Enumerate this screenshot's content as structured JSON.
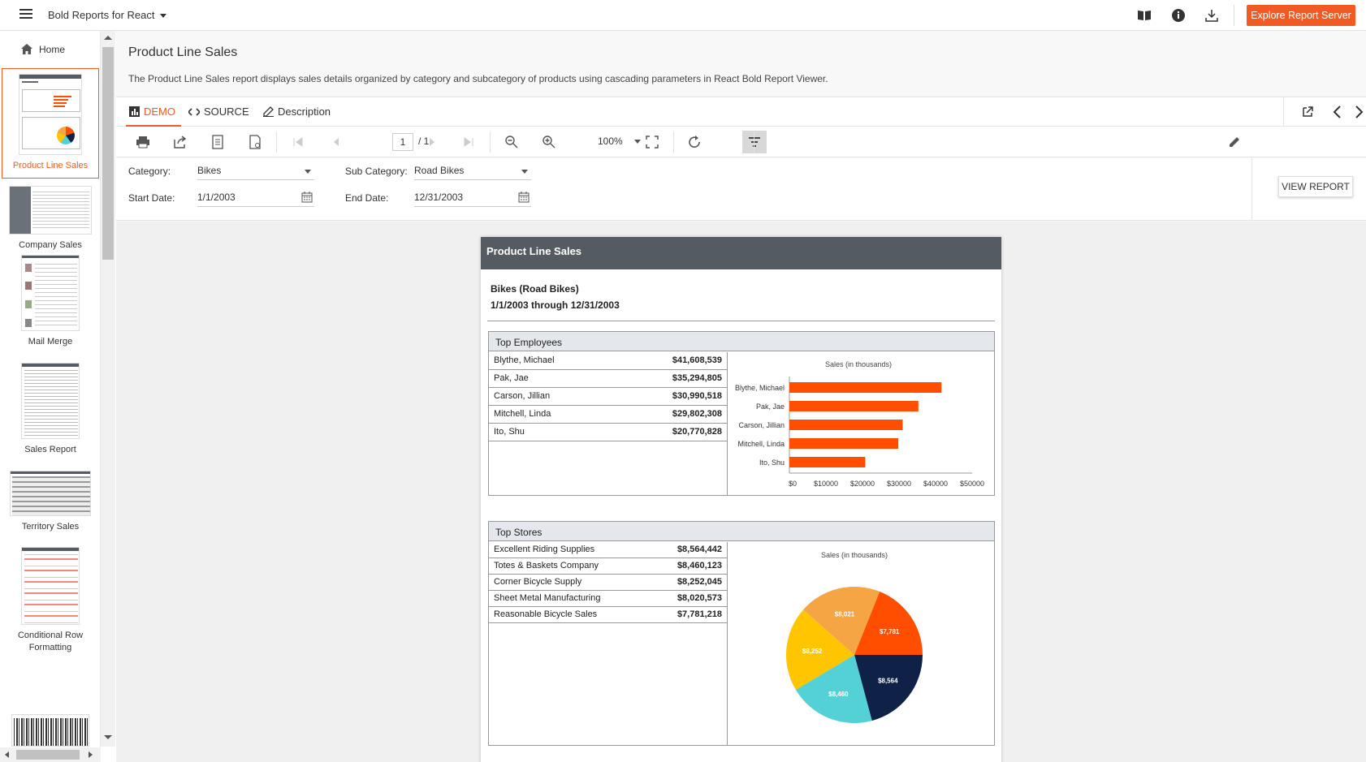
{
  "app": {
    "title": "Bold Reports for React",
    "explore_button": "Explore Report Server",
    "icons": [
      "book-icon",
      "info-icon",
      "download-icon"
    ]
  },
  "sidebar": {
    "home": "Home",
    "items": [
      {
        "label": "Product Line Sales",
        "active": true
      },
      {
        "label": "Company Sales",
        "active": false
      },
      {
        "label": "Mail Merge",
        "active": false
      },
      {
        "label": "Sales Report",
        "active": false
      },
      {
        "label": "Territory Sales",
        "active": false
      },
      {
        "label": "Conditional Row Formatting",
        "active": false
      }
    ]
  },
  "page": {
    "title": "Product Line Sales",
    "description": "The Product Line Sales report displays sales details organized by category and subcategory of products using cascading parameters in React Bold Report Viewer."
  },
  "tabs": [
    {
      "label": "DEMO",
      "active": true
    },
    {
      "label": "SOURCE",
      "active": false
    },
    {
      "label": "Description",
      "active": false
    }
  ],
  "toolbar": {
    "current_page": "1",
    "total_pages": "/ 1",
    "zoom": "100%"
  },
  "params": {
    "category_label": "Category:",
    "category_value": "Bikes",
    "subcategory_label": "Sub Category:",
    "subcategory_value": "Road Bikes",
    "start_label": "Start Date:",
    "start_value": "1/1/2003",
    "end_label": "End Date:",
    "end_value": "12/31/2003",
    "view_button": "VIEW REPORT"
  },
  "report": {
    "header": "Product Line Sales",
    "subtitle": "Bikes (Road Bikes)",
    "date_range": "1/1/2003 through 12/31/2003",
    "employees": {
      "title": "Top Employees",
      "rows": [
        {
          "name": "Blythe, Michael",
          "value": "$41,608,539"
        },
        {
          "name": "Pak, Jae",
          "value": "$35,294,805"
        },
        {
          "name": "Carson, Jillian",
          "value": "$30,990,518"
        },
        {
          "name": "Mitchell, Linda",
          "value": "$29,802,308"
        },
        {
          "name": "Ito, Shu",
          "value": "$20,770,828"
        }
      ]
    },
    "stores": {
      "title": "Top Stores",
      "rows": [
        {
          "name": "Excellent Riding Supplies",
          "value": "$8,564,442"
        },
        {
          "name": "Totes & Baskets Company",
          "value": "$8,460,123"
        },
        {
          "name": "Corner Bicycle Supply",
          "value": "$8,252,045"
        },
        {
          "name": "Sheet Metal Manufacturing",
          "value": "$8,020,573"
        },
        {
          "name": "Reasonable Bicycle Sales",
          "value": "$7,781,218"
        }
      ]
    }
  },
  "chart_data": [
    {
      "type": "bar",
      "orientation": "horizontal",
      "title": "Sales (in thousands)",
      "categories": [
        "Blythe, Michael",
        "Pak, Jae",
        "Carson, Jillian",
        "Mitchell, Linda",
        "Ito, Shu"
      ],
      "values": [
        41609,
        35295,
        30991,
        29802,
        20771
      ],
      "xticks": [
        "$0",
        "$10000",
        "$20000",
        "$30000",
        "$40000",
        "$50000"
      ],
      "xlim": [
        0,
        50000
      ],
      "color": "#ff4e00"
    },
    {
      "type": "pie",
      "title": "Sales (in thousands)",
      "labels": [
        "$8,564",
        "$8,460",
        "$8,252",
        "$8,021",
        "$7,781"
      ],
      "values": [
        8564,
        8460,
        8252,
        8021,
        7781
      ],
      "colors": [
        "#0f2147",
        "#53d1d6",
        "#ffc600",
        "#f6a544",
        "#ff4e00"
      ]
    }
  ]
}
